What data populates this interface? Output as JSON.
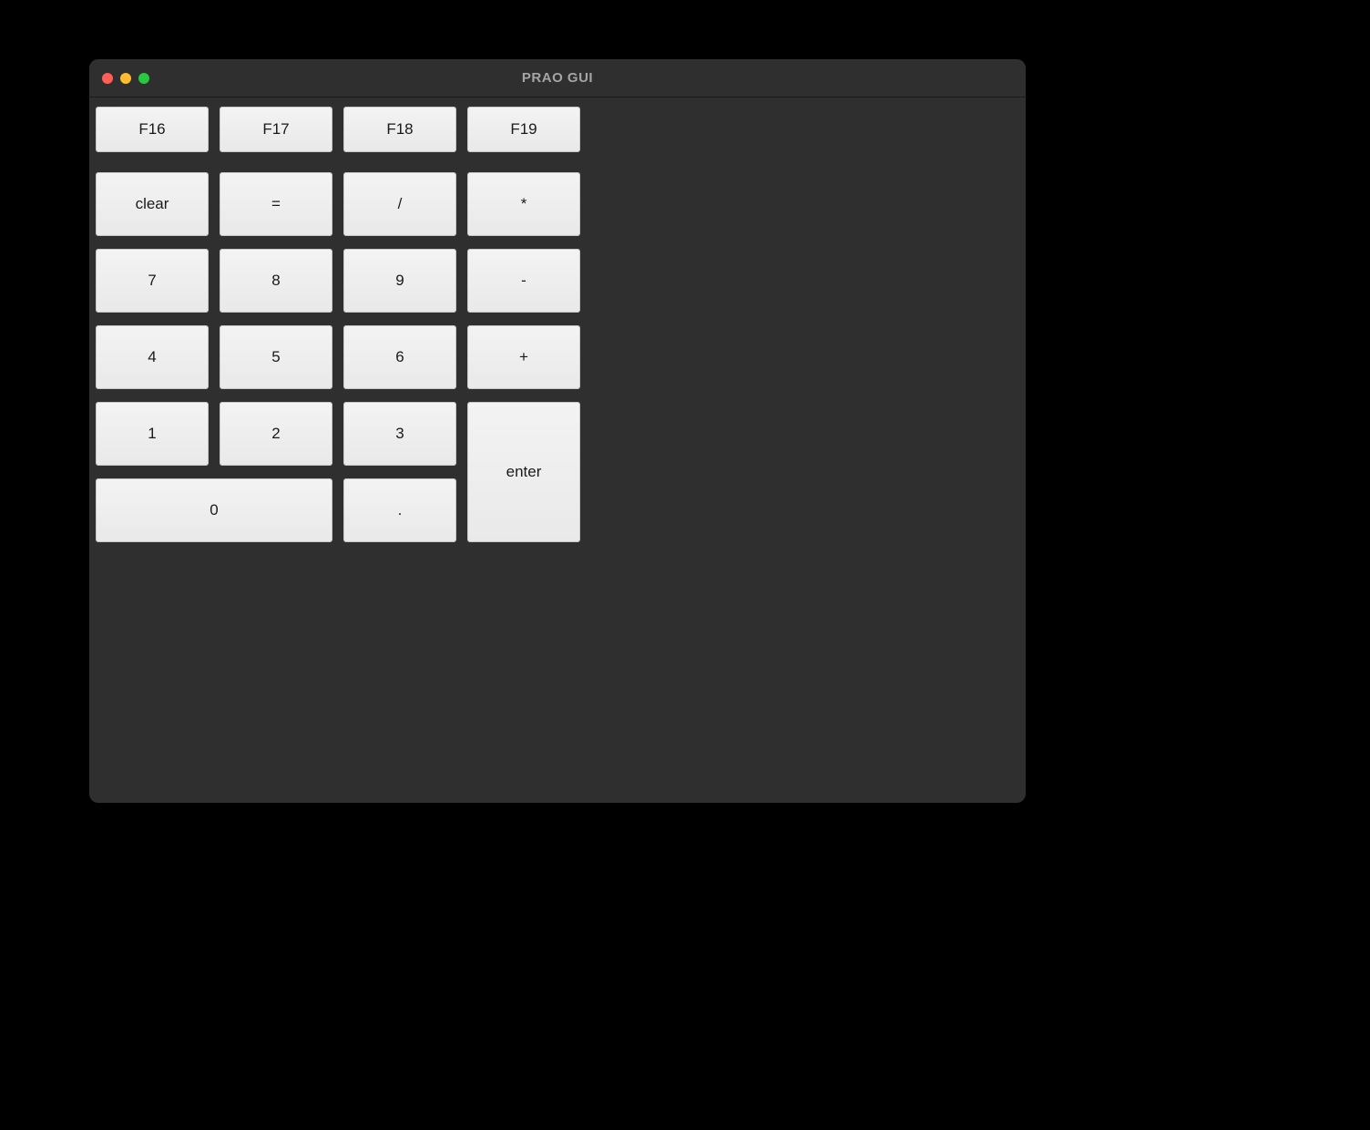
{
  "window": {
    "title": "PRAO GUI"
  },
  "keys": {
    "f16": "F16",
    "f17": "F17",
    "f18": "F18",
    "f19": "F19",
    "clear": "clear",
    "equals": "=",
    "divide": "/",
    "multiply": "*",
    "seven": "7",
    "eight": "8",
    "nine": "9",
    "minus": "-",
    "four": "4",
    "five": "5",
    "six": "6",
    "plus": "+",
    "one": "1",
    "two": "2",
    "three": "3",
    "enter": "enter",
    "zero": "0",
    "dot": "."
  }
}
